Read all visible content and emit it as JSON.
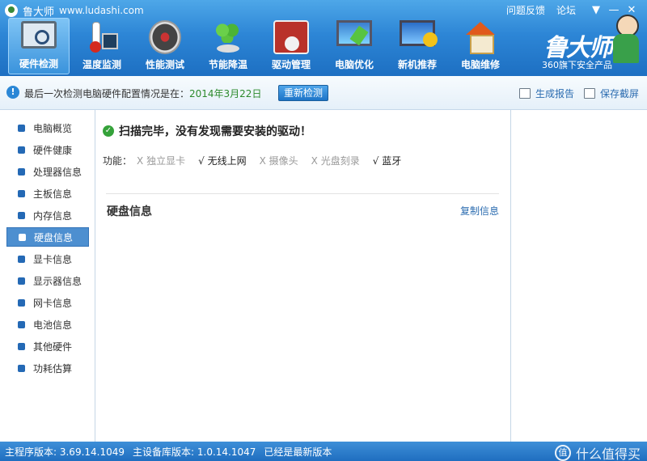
{
  "app": {
    "name": "鲁大师",
    "url": "www.ludashi.com"
  },
  "top_links": {
    "feedback": "问题反馈",
    "forum": "论坛"
  },
  "window_controls": {
    "menu": "▼",
    "minimize": "—",
    "close": "✕"
  },
  "toolbar": [
    {
      "label": "硬件检测",
      "icon": "monitor-magnifier-icon",
      "active": true
    },
    {
      "label": "温度监测",
      "icon": "thermometer-icon",
      "active": false
    },
    {
      "label": "性能测试",
      "icon": "speed-gauge-icon",
      "active": false
    },
    {
      "label": "节能降温",
      "icon": "clover-icon",
      "active": false
    },
    {
      "label": "驱动管理",
      "icon": "driver-box-icon",
      "active": false
    },
    {
      "label": "电脑优化",
      "icon": "pc-optimize-icon",
      "active": false
    },
    {
      "label": "新机推荐",
      "icon": "new-pc-award-icon",
      "active": false
    },
    {
      "label": "电脑维修",
      "icon": "house-repair-icon",
      "active": false
    }
  ],
  "brand": {
    "name": "鲁大师",
    "subtitle": "360旗下安全产品"
  },
  "infobar": {
    "message": "最后一次检测电脑硬件配置情况是在：",
    "date": "2014年3月22日",
    "recheck_button": "重新检测",
    "report": "生成报告",
    "screenshot": "保存截屏"
  },
  "sidebar": {
    "items": [
      {
        "label": "电脑概览"
      },
      {
        "label": "硬件健康"
      },
      {
        "label": "处理器信息"
      },
      {
        "label": "主板信息"
      },
      {
        "label": "内存信息"
      },
      {
        "label": "硬盘信息",
        "active": true
      },
      {
        "label": "显卡信息"
      },
      {
        "label": "显示器信息"
      },
      {
        "label": "网卡信息"
      },
      {
        "label": "电池信息"
      },
      {
        "label": "其他硬件"
      },
      {
        "label": "功耗估算"
      }
    ]
  },
  "main": {
    "scan_status": "扫描完毕，没有发现需要安装的驱动！",
    "features_label": "功能：",
    "features": [
      {
        "mark": "X",
        "name": "独立显卡",
        "available": false
      },
      {
        "mark": "√",
        "name": "无线上网",
        "available": true
      },
      {
        "mark": "X",
        "name": "摄像头",
        "available": false
      },
      {
        "mark": "X",
        "name": "光盘刻录",
        "available": false
      },
      {
        "mark": "√",
        "name": "蓝牙",
        "available": true
      }
    ],
    "section_title": "硬盘信息",
    "copy_link": "复制信息"
  },
  "statusbar": {
    "program_version": "主程序版本: 3.69.14.1049",
    "db_version": "主设备库版本: 1.0.14.1047",
    "latest": "已经是最新版本",
    "watermark": "什么值得买",
    "watermark_mark": "值"
  },
  "colors": {
    "header_blue": "#2d86d6",
    "active_item": "#4d8fd0",
    "date_green": "#2c8a2c",
    "link_blue": "#2b6cb0"
  }
}
